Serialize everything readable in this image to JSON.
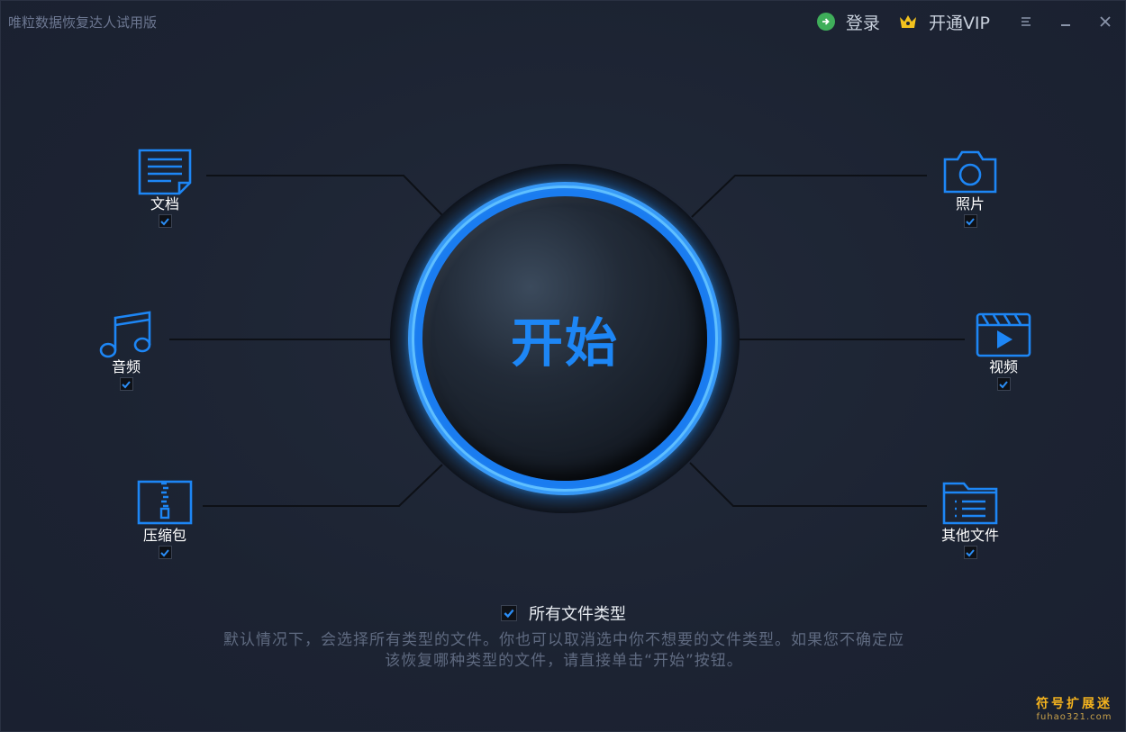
{
  "app": {
    "title": "唯粒数据恢复达人试用版"
  },
  "titlebar": {
    "login_label": "登录",
    "vip_label": "开通VIP"
  },
  "center": {
    "start_label": "开始"
  },
  "file_types": [
    {
      "label": "文档",
      "icon": "document-icon",
      "checked": true
    },
    {
      "label": "音频",
      "icon": "music-note-icon",
      "checked": true
    },
    {
      "label": "压缩包",
      "icon": "zip-archive-icon",
      "checked": true
    },
    {
      "label": "照片",
      "icon": "camera-icon",
      "checked": true
    },
    {
      "label": "视频",
      "icon": "video-clapper-icon",
      "checked": true
    },
    {
      "label": "其他文件",
      "icon": "folder-icon",
      "checked": true
    }
  ],
  "bottom": {
    "all_types_label": "所有文件类型",
    "all_types_checked": true,
    "hint_line1": "默认情况下，会选择所有类型的文件。你也可以取消选中你不想要的文件类型。如果您不确定应",
    "hint_line2": "该恢复哪种类型的文件，请直接单击“开始”按钮。"
  },
  "watermark": {
    "top": "符号扩展迷",
    "bottom": "fuhao321.com"
  },
  "colors": {
    "accent": "#1d86f5",
    "background": "#1d2434",
    "login_green": "#3fae5a",
    "vip_gold": "#f3c21e"
  }
}
